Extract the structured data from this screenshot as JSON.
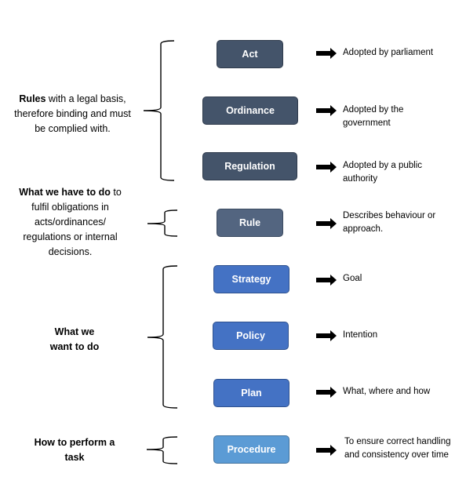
{
  "groups": [
    {
      "label_bold": "Rules",
      "label_rest": " with a legal basis, therefore binding and must be complied with."
    },
    {
      "label_bold": "What we have to do",
      "label_rest": " to fulfil obligations in acts/ordinances/ regulations or internal decisions."
    },
    {
      "label_bold": "What we want to do",
      "label_rest": ""
    },
    {
      "label_bold": "How to perform a task",
      "label_rest": ""
    }
  ],
  "items": [
    {
      "name": "Act",
      "description": "Adopted by parliament"
    },
    {
      "name": "Ordinance",
      "description": "Adopted by the government"
    },
    {
      "name": "Regulation",
      "description": "Adopted by a public authority"
    },
    {
      "name": "Rule",
      "description": "Describes behaviour or approach."
    },
    {
      "name": "Strategy",
      "description": "Goal"
    },
    {
      "name": "Policy",
      "description": "Intention"
    },
    {
      "name": "Plan",
      "description": "What, where and how"
    },
    {
      "name": "Procedure",
      "description": "To ensure correct handling and consistency over time"
    }
  ],
  "colors": {
    "legal": "#44546A",
    "rule": "#536580",
    "intent": "#4472C4",
    "procedure": "#5B9BD5"
  }
}
